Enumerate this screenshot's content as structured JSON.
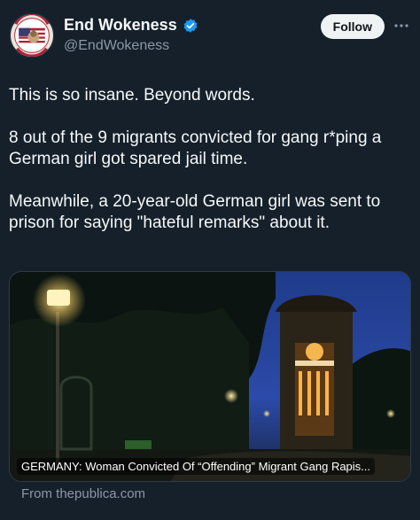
{
  "author": {
    "display_name": "End Wokeness",
    "handle": "@EndWokeness",
    "avatar_icon": "i-support-flag-badge-icon",
    "verified_icon": "verified-badge-icon",
    "verified_color": "#1d9bf0"
  },
  "actions": {
    "follow_label": "Follow",
    "more_icon": "more-dots-icon"
  },
  "tweet": {
    "paragraphs": [
      "This is so insane. Beyond words.",
      "8 out of the 9 migrants convicted for gang r*ping a German girl got spared jail time.",
      "Meanwhile, a 20-year-old German girl was sent to prison for saying \"hateful remarks\" about it."
    ]
  },
  "link_card": {
    "title": "GERMANY: Woman Convicted Of “Offending” Migrant Gang Rapis...",
    "image_description_icon": "night-park-streetlamp-tower-image",
    "source": "From thepublica.com"
  },
  "colors": {
    "background": "#15202b",
    "text_primary": "#f7f9f9",
    "text_secondary": "#8b98a5",
    "follow_bg": "#eff3f4"
  }
}
